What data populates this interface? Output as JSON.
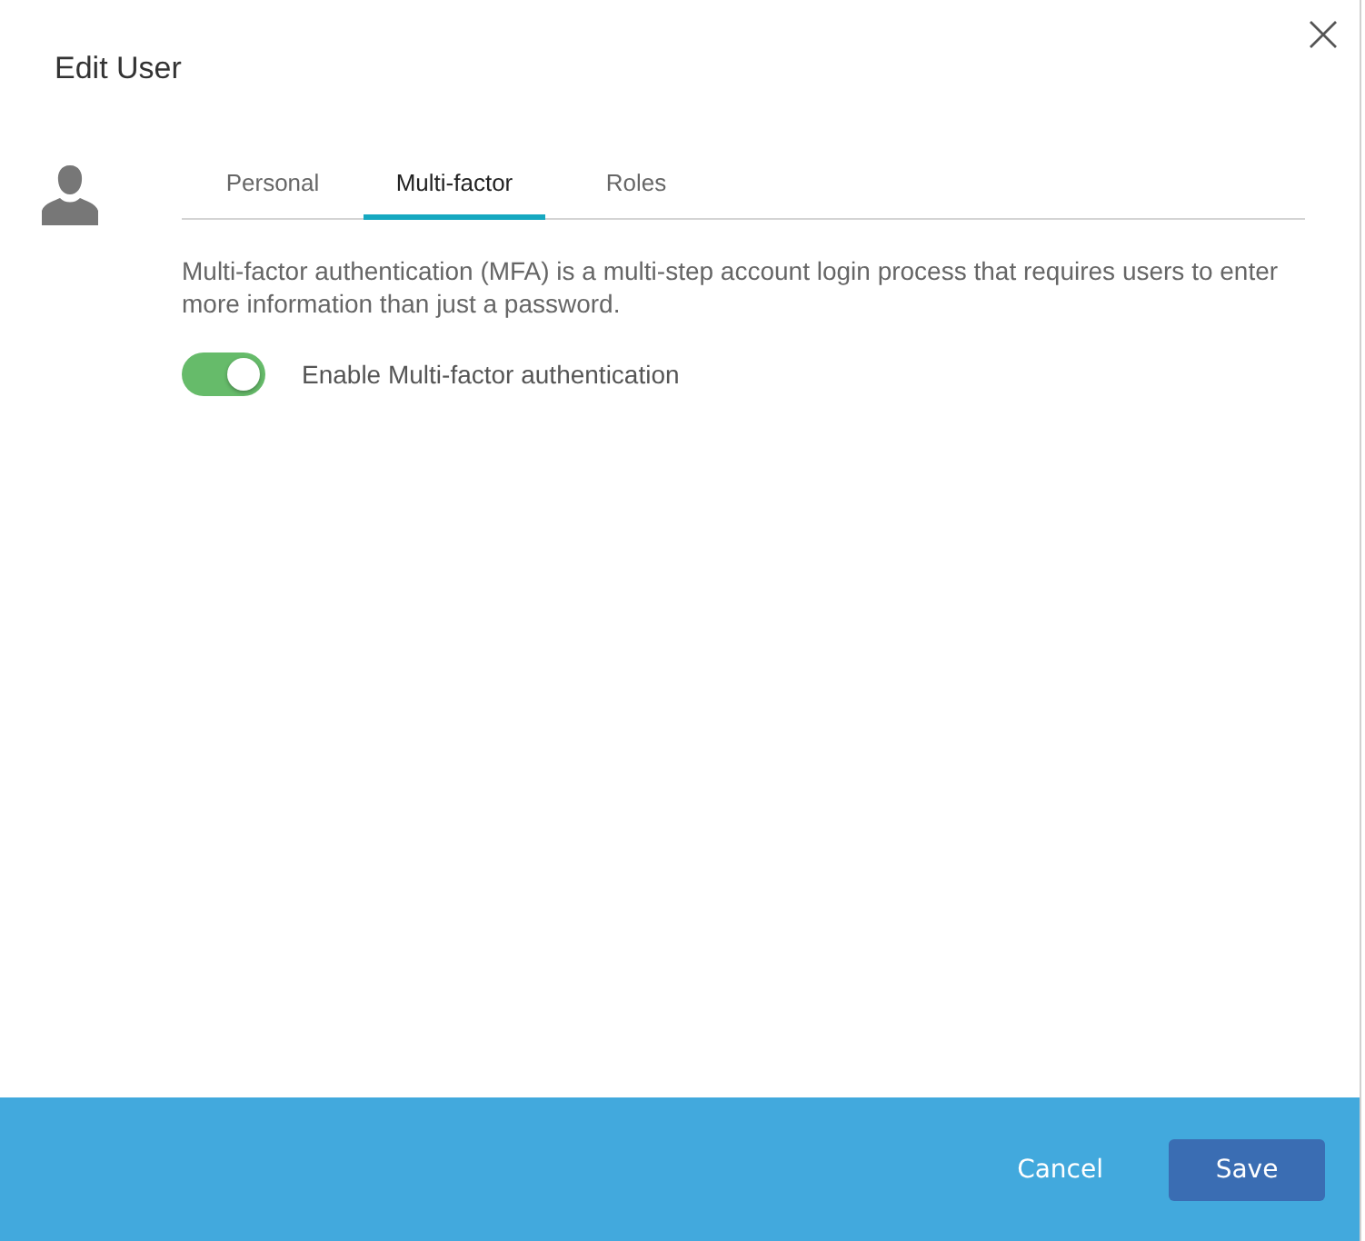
{
  "dialog": {
    "title": "Edit User"
  },
  "tabs": [
    {
      "label": "Personal",
      "selected": false
    },
    {
      "label": "Multi-factor",
      "selected": true
    },
    {
      "label": "Roles",
      "selected": false
    }
  ],
  "description": "Multi-factor authentication (MFA) is a multi-step account login process that requires users to enter more information than just a password.",
  "toggle": {
    "label": "Enable Multi-factor authentication",
    "on": true
  },
  "buttons": [
    {
      "label": "Cancel",
      "kind": "link"
    },
    {
      "label": "Save",
      "kind": "primary"
    }
  ]
}
